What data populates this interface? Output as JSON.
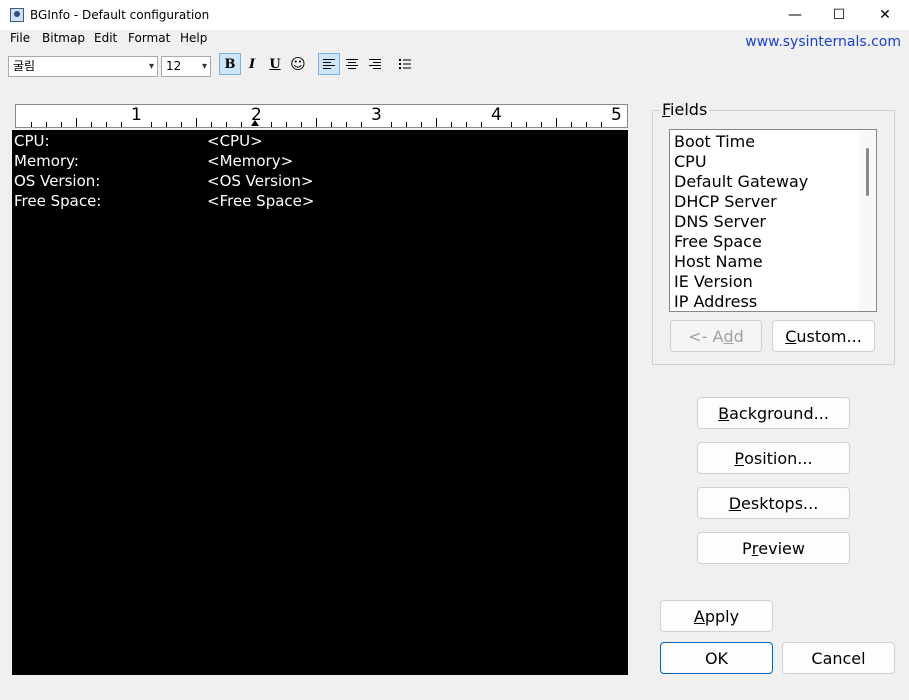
{
  "window": {
    "title": "BGInfo - Default configuration",
    "minimize_glyph": "—",
    "maximize_glyph": "☐",
    "close_glyph": "✕"
  },
  "menu": {
    "items": [
      "File",
      "Bitmap",
      "Edit",
      "Format",
      "Help"
    ],
    "link": "www.sysinternals.com"
  },
  "toolbar": {
    "font_name": "굴림",
    "font_size": "12",
    "bold": "B",
    "italic": "I",
    "underline": "U",
    "color_glyph": "☺",
    "align_left_active": true
  },
  "ruler": {
    "numbers": [
      "1",
      "2",
      "3",
      "4",
      "5"
    ]
  },
  "editor": {
    "lines": [
      {
        "label": "CPU:",
        "value": "<CPU>"
      },
      {
        "label": "Memory:",
        "value": "<Memory>"
      },
      {
        "label": "OS Version:",
        "value": "<OS Version>"
      },
      {
        "label": "Free Space:",
        "value": "<Free Space>"
      }
    ],
    "background_color": "#000000",
    "text_color": "#ffffff"
  },
  "fields": {
    "group_label": "Fields",
    "items": [
      "Boot Time",
      "CPU",
      "Default Gateway",
      "DHCP Server",
      "DNS Server",
      "Free Space",
      "Host Name",
      "IE Version",
      "IP Address"
    ],
    "add_label": "<- Add",
    "custom_label": "Custom..."
  },
  "buttons": {
    "background": "Background...",
    "position": "Position...",
    "desktops": "Desktops...",
    "preview": "Preview",
    "apply": "Apply",
    "ok": "OK",
    "cancel": "Cancel"
  }
}
